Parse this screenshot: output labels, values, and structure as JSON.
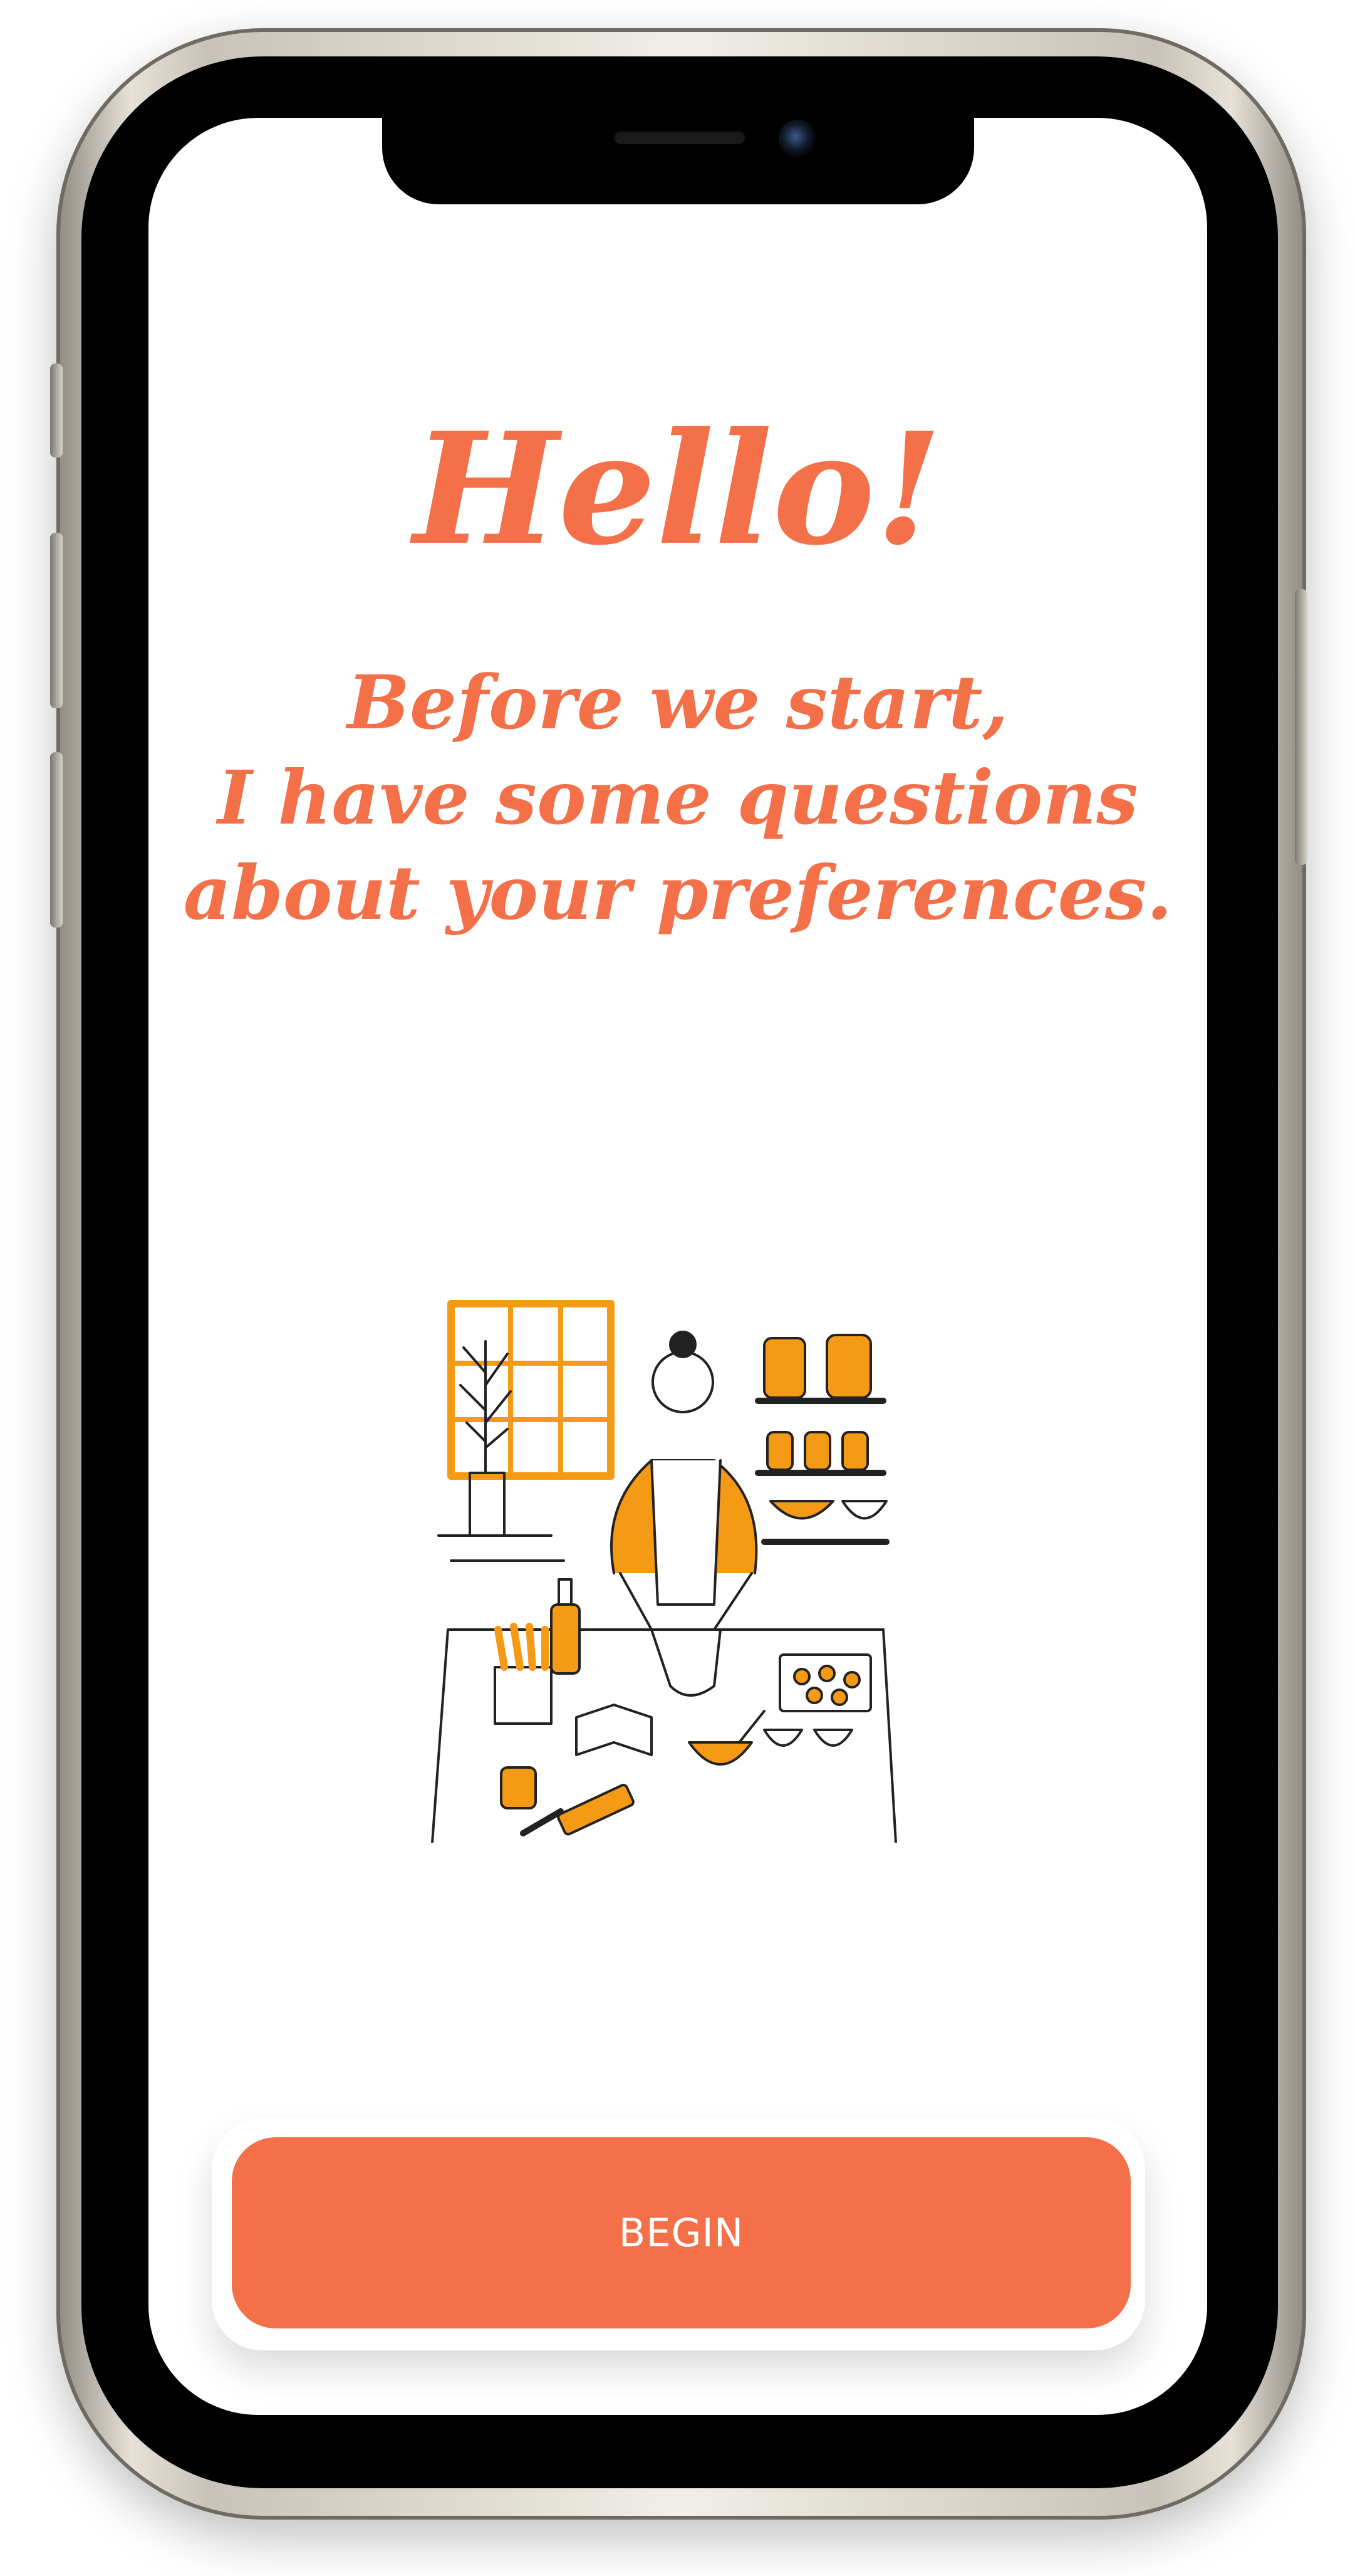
{
  "screen": {
    "title": "Hello!",
    "subtitle": "Before we start,\n I have some questions\nabout your preferences.",
    "begin_button_label": "BEGIN"
  },
  "colors": {
    "accent": "#f47048",
    "illustration_orange": "#f59a15",
    "background": "#ffffff"
  },
  "illustration": {
    "icon": "woman-cooking-illustration"
  }
}
